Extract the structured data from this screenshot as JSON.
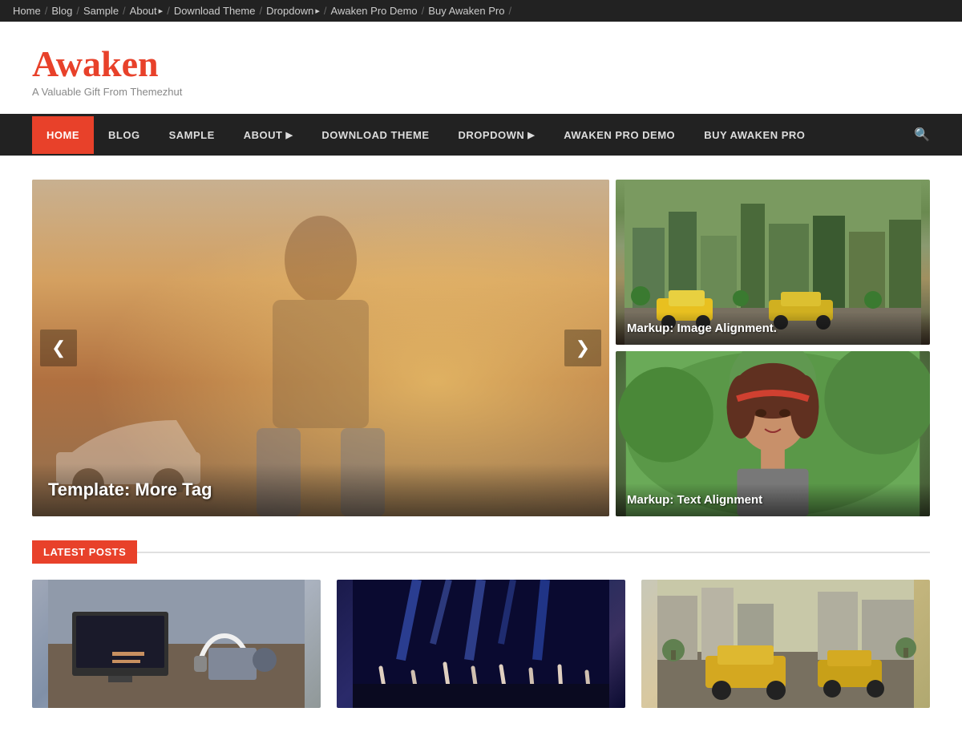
{
  "topbar": {
    "items": [
      {
        "label": "Home",
        "has_arrow": false
      },
      {
        "label": "Blog",
        "has_arrow": false
      },
      {
        "label": "Sample",
        "has_arrow": false
      },
      {
        "label": "About",
        "has_arrow": true
      },
      {
        "label": "Download Theme",
        "has_arrow": false
      },
      {
        "label": "Dropdown",
        "has_arrow": true
      },
      {
        "label": "Awaken Pro Demo",
        "has_arrow": false
      },
      {
        "label": "Buy Awaken Pro",
        "has_arrow": false
      }
    ]
  },
  "header": {
    "title": "Awaken",
    "tagline": "A Valuable Gift From Themezhut"
  },
  "nav": {
    "items": [
      {
        "label": "HOME",
        "active": true,
        "has_arrow": false
      },
      {
        "label": "BLOG",
        "active": false,
        "has_arrow": false
      },
      {
        "label": "SAMPLE",
        "active": false,
        "has_arrow": false
      },
      {
        "label": "ABOUT",
        "active": false,
        "has_arrow": true
      },
      {
        "label": "DOWNLOAD THEME",
        "active": false,
        "has_arrow": false
      },
      {
        "label": "DROPDOWN",
        "active": false,
        "has_arrow": true
      },
      {
        "label": "AWAKEN PRO DEMO",
        "active": false,
        "has_arrow": false
      },
      {
        "label": "BUY AWAKEN PRO",
        "active": false,
        "has_arrow": false
      }
    ],
    "search_icon": "🔍"
  },
  "hero": {
    "main_caption": "Template: More Tag",
    "prev_label": "❮",
    "next_label": "❯",
    "side_items": [
      {
        "caption": "Markup: Image Alignment."
      },
      {
        "caption": "Markup: Text Alignment"
      }
    ]
  },
  "latest_posts": {
    "section_label": "LATEST POSTS"
  }
}
